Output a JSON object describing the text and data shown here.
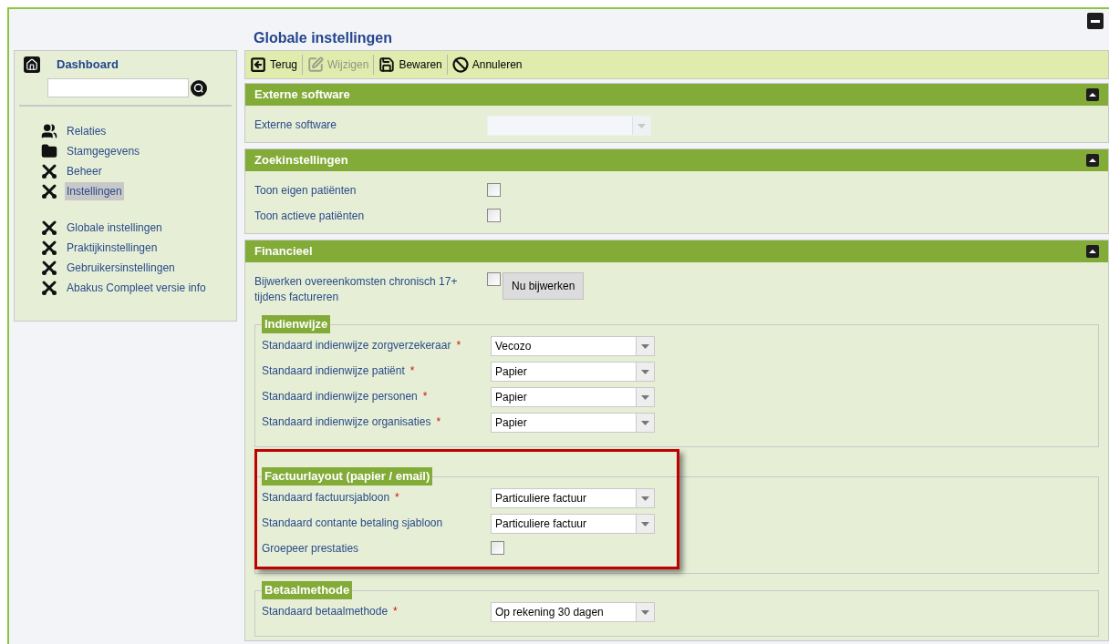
{
  "page_title": "Globale instellingen",
  "sidebar": {
    "dashboard": "Dashboard",
    "main_items": [
      {
        "label": "Relaties",
        "kind": "people",
        "selected": false
      },
      {
        "label": "Stamgegevens",
        "kind": "folder",
        "selected": false
      },
      {
        "label": "Beheer",
        "kind": "tools",
        "selected": false
      },
      {
        "label": "Instellingen",
        "kind": "tools",
        "selected": true
      }
    ],
    "sub_items": [
      {
        "label": "Globale instellingen",
        "kind": "tools",
        "selected": false
      },
      {
        "label": "Praktijkinstellingen",
        "kind": "tools",
        "selected": false
      },
      {
        "label": "Gebruikersinstellingen",
        "kind": "tools",
        "selected": false
      },
      {
        "label": "Abakus Compleet versie info",
        "kind": "tools",
        "selected": false
      }
    ]
  },
  "toolbar": [
    {
      "label": "Terug",
      "kind": "back",
      "disabled": false
    },
    {
      "label": "Wijzigen",
      "kind": "edit",
      "disabled": true
    },
    {
      "label": "Bewaren",
      "kind": "save",
      "disabled": false
    },
    {
      "label": "Annuleren",
      "kind": "cancel",
      "disabled": false
    }
  ],
  "sections": [
    {
      "title": "Externe software",
      "expanded": true,
      "rows": [
        {
          "kind": "select",
          "label": "Externe software",
          "disabled": true
        }
      ]
    },
    {
      "title": "Zoekinstellingen",
      "expanded": true,
      "rows": [
        {
          "kind": "checkbox",
          "label": "Toon eigen patiënten",
          "checked": false
        },
        {
          "kind": "checkbox",
          "label": "Toon actieve patiënten",
          "checked": false
        }
      ]
    },
    {
      "title": "Financieel",
      "expanded": true,
      "rows": [
        {
          "kind": "checkbox_button",
          "label": "Bijwerken overeenkomsten chronisch 17+ tijdens factureren",
          "checked": false,
          "button": "Nu bijwerken"
        }
      ],
      "fieldsets": [
        {
          "legend": "Indienwijze",
          "highlighted": false,
          "rows": [
            {
              "kind": "select",
              "label": "Standaard indienwijze zorgverzekeraar",
              "required_mark": "*",
              "value": "Vecozo",
              "disabled": false
            },
            {
              "kind": "select",
              "label": "Standaard indienwijze patiënt",
              "required_mark": "*",
              "value": "Papier",
              "disabled": false
            },
            {
              "kind": "select",
              "label": "Standaard indienwijze personen",
              "required_mark": "*",
              "value": "Papier",
              "disabled": false
            },
            {
              "kind": "select",
              "label": "Standaard indienwijze organisaties",
              "required_mark": "*",
              "value": "Papier",
              "disabled": false
            }
          ]
        },
        {
          "legend": "Factuurlayout (papier / email)",
          "highlighted": true,
          "rows": [
            {
              "kind": "select",
              "label": "Standaard factuursjabloon",
              "required_mark": "*",
              "value": "Particuliere factuur",
              "disabled": false
            },
            {
              "kind": "select",
              "label": "Standaard contante betaling sjabloon",
              "value": "Particuliere factuur",
              "disabled": false
            },
            {
              "kind": "checkbox",
              "label": "Groepeer prestaties",
              "checked": false
            }
          ]
        },
        {
          "legend": "Betaalmethode",
          "highlighted": false,
          "rows": [
            {
              "kind": "select",
              "label": "Standaard betaalmethode",
              "required_mark": "*",
              "value": "Op rekening 30 dagen",
              "disabled": false
            }
          ]
        }
      ]
    }
  ]
}
